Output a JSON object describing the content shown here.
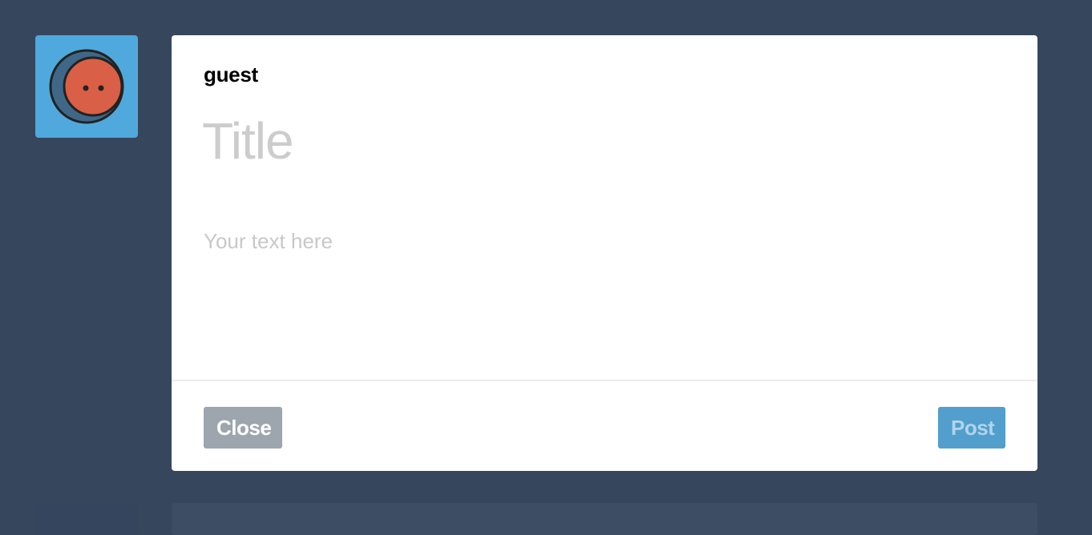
{
  "post_form": {
    "username": "guest",
    "title_placeholder": "Title",
    "title_value": "",
    "body_placeholder": "Your text here",
    "body_value": "",
    "close_label": "Close",
    "post_label": "Post"
  },
  "avatar": {
    "icon": "face-icon",
    "background_color": "#4fa9dc",
    "face_color": "#d95f46",
    "shadow_color": "#3f6888"
  },
  "colors": {
    "page_background": "#36465d",
    "card_background": "#ffffff",
    "close_button": "#9da6af",
    "post_button": "#529ecc",
    "placeholder_text": "#cccccc"
  }
}
